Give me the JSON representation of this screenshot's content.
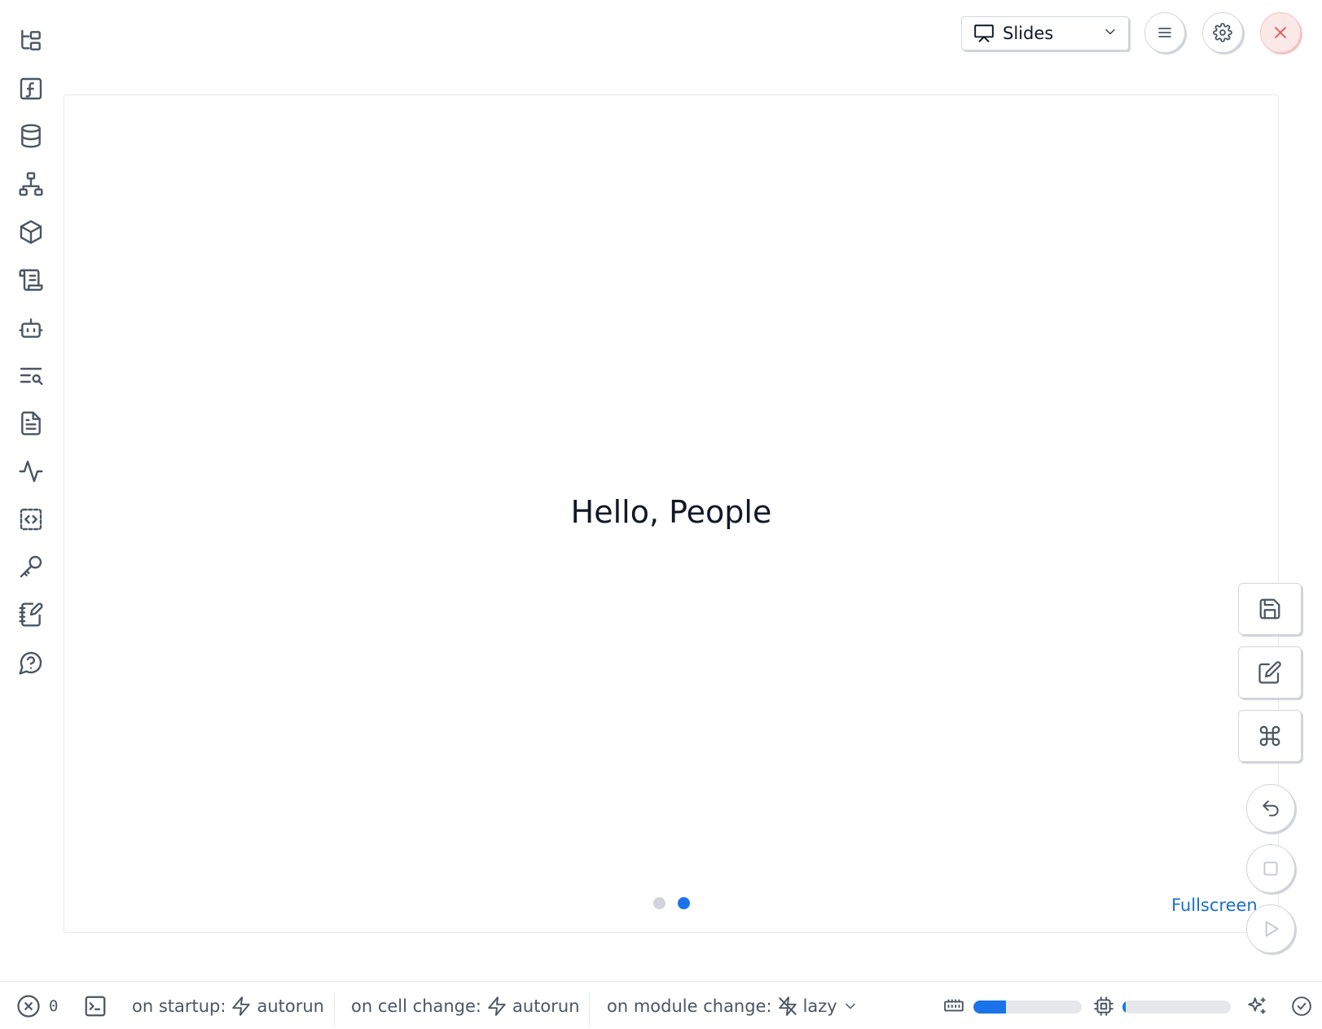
{
  "sidebar": {
    "items": [
      {
        "icon": "file-tree-icon"
      },
      {
        "icon": "function-icon"
      },
      {
        "icon": "database-icon"
      },
      {
        "icon": "hierarchy-icon"
      },
      {
        "icon": "package-icon"
      },
      {
        "icon": "scroll-icon"
      },
      {
        "icon": "bot-icon"
      },
      {
        "icon": "text-search-icon"
      },
      {
        "icon": "document-icon"
      },
      {
        "icon": "activity-icon"
      },
      {
        "icon": "code-snippet-icon"
      },
      {
        "icon": "key-icon"
      },
      {
        "icon": "notebook-pen-icon"
      },
      {
        "icon": "help-chat-icon"
      }
    ]
  },
  "header": {
    "view_mode": "Slides"
  },
  "slide": {
    "text": "Hello, People",
    "count": 2,
    "active_index": 1,
    "fullscreen_label": "Fullscreen"
  },
  "footer": {
    "error_count": "0",
    "startup_label": "on startup:",
    "startup_value": "autorun",
    "cell_change_label": "on cell change:",
    "cell_change_value": "autorun",
    "module_change_label": "on module change:",
    "module_change_value": "lazy",
    "memory_usage": 0.3,
    "cpu_usage": 0.03
  },
  "colors": {
    "accent": "#1a73e8",
    "link": "#1a6fd1",
    "icon": "#4b5563",
    "danger": "#e25555"
  }
}
